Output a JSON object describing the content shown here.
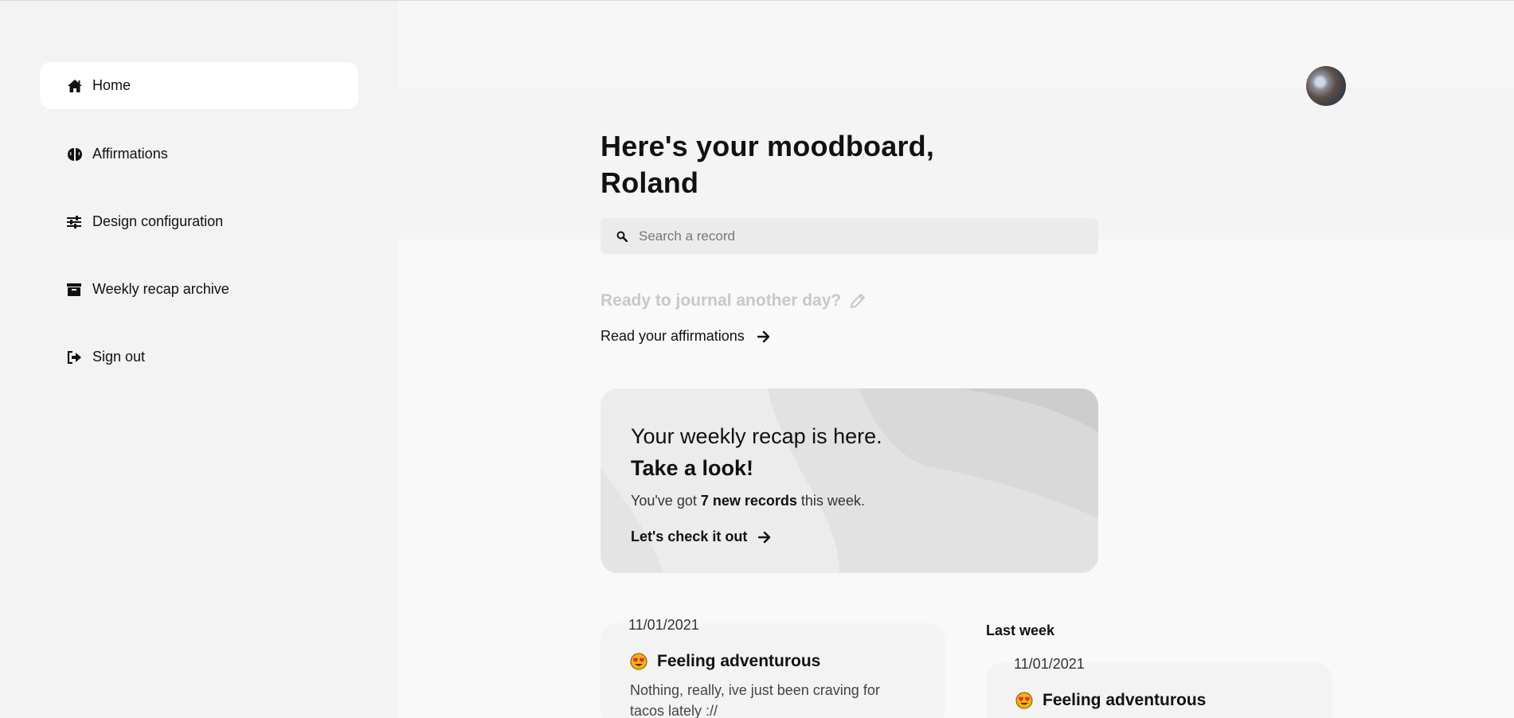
{
  "sidebar": {
    "items": [
      {
        "label": "Home",
        "icon": "home-icon",
        "active": true
      },
      {
        "label": "Affirmations",
        "icon": "brain-icon",
        "active": false
      },
      {
        "label": "Design configuration",
        "icon": "sliders-icon",
        "active": false
      },
      {
        "label": "Weekly recap archive",
        "icon": "archive-icon",
        "active": false
      },
      {
        "label": "Sign out",
        "icon": "sign-out-icon",
        "active": false
      }
    ]
  },
  "header": {
    "avatar_icon": "user-avatar"
  },
  "greeting": {
    "line1": "Here's your moodboard,",
    "name": "Roland"
  },
  "search": {
    "placeholder": "Search a record",
    "icon": "search-icon"
  },
  "journal_prompt": {
    "text": "Ready to journal another day?",
    "icon": "pencil-icon"
  },
  "affirmations_link": {
    "label": "Read your affirmations",
    "icon": "arrow-right-icon"
  },
  "recap": {
    "title_line1": "Your weekly recap is here.",
    "title_line2": "Take a look!",
    "text_prefix": "You've got ",
    "text_bold": "7 new records",
    "text_suffix": " this week.",
    "link_label": "Let's check it out",
    "link_icon": "arrow-right-icon"
  },
  "records": [
    {
      "date": "11/01/2021",
      "mood": "Feeling adventurous",
      "emoji": "heart-eyes-emoji",
      "body": "Nothing, really, ive just been craving for tacos lately ://"
    }
  ],
  "last_week": {
    "label": "Last week",
    "records": [
      {
        "date": "11/01/2021",
        "mood": "Feeling adventurous",
        "emoji": "heart-eyes-emoji"
      }
    ]
  },
  "colors": {
    "sidebar_bg": "#f3f3f3",
    "active_nav_bg": "#ffffff",
    "card_bg": "#ececec",
    "muted_text": "#c8c8c8"
  }
}
